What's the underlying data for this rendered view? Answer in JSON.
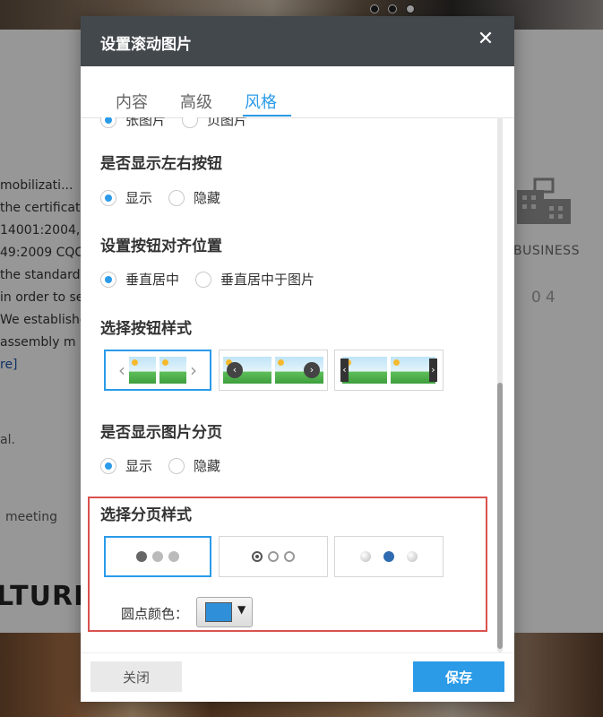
{
  "background": {
    "text_lines": [
      "mobilizati...",
      "the certificat",
      "14001:2004,",
      "49:2009 CQC",
      "the standard",
      "in order to se",
      "We establishe",
      "assembly m",
      "re]"
    ],
    "snippet_al": "al.",
    "snippet_meeting": "meeting",
    "culture": "LTURE",
    "business": "BUSINESS",
    "number": "04"
  },
  "dialog": {
    "title": "设置滚动图片",
    "tabs": [
      {
        "label": "内容",
        "active": false
      },
      {
        "label": "高级",
        "active": false
      },
      {
        "label": "风格",
        "active": true
      }
    ],
    "clipped_row": {
      "opt1": "张图片",
      "opt2": "页图片"
    },
    "sections": {
      "show_buttons": {
        "title": "是否显示左右按钮",
        "options": [
          {
            "label": "显示",
            "checked": true
          },
          {
            "label": "隐藏",
            "checked": false
          }
        ]
      },
      "button_align": {
        "title": "设置按钮对齐位置",
        "options": [
          {
            "label": "垂直居中",
            "checked": true
          },
          {
            "label": "垂直居中于图片",
            "checked": false
          }
        ]
      },
      "button_style": {
        "title": "选择按钮样式",
        "selected_index": 0
      },
      "show_pagination": {
        "title": "是否显示图片分页",
        "options": [
          {
            "label": "显示",
            "checked": true
          },
          {
            "label": "隐藏",
            "checked": false
          }
        ]
      },
      "pagination_style": {
        "title": "选择分页样式",
        "selected_index": 0,
        "color_label": "圆点颜色：",
        "color_value": "#2f8fd8"
      }
    },
    "footer": {
      "close_label": "关闭",
      "save_label": "保存"
    }
  },
  "colors": {
    "accent": "#2b9be8",
    "header_bg": "#43484d",
    "highlight_border": "#d9534f"
  }
}
